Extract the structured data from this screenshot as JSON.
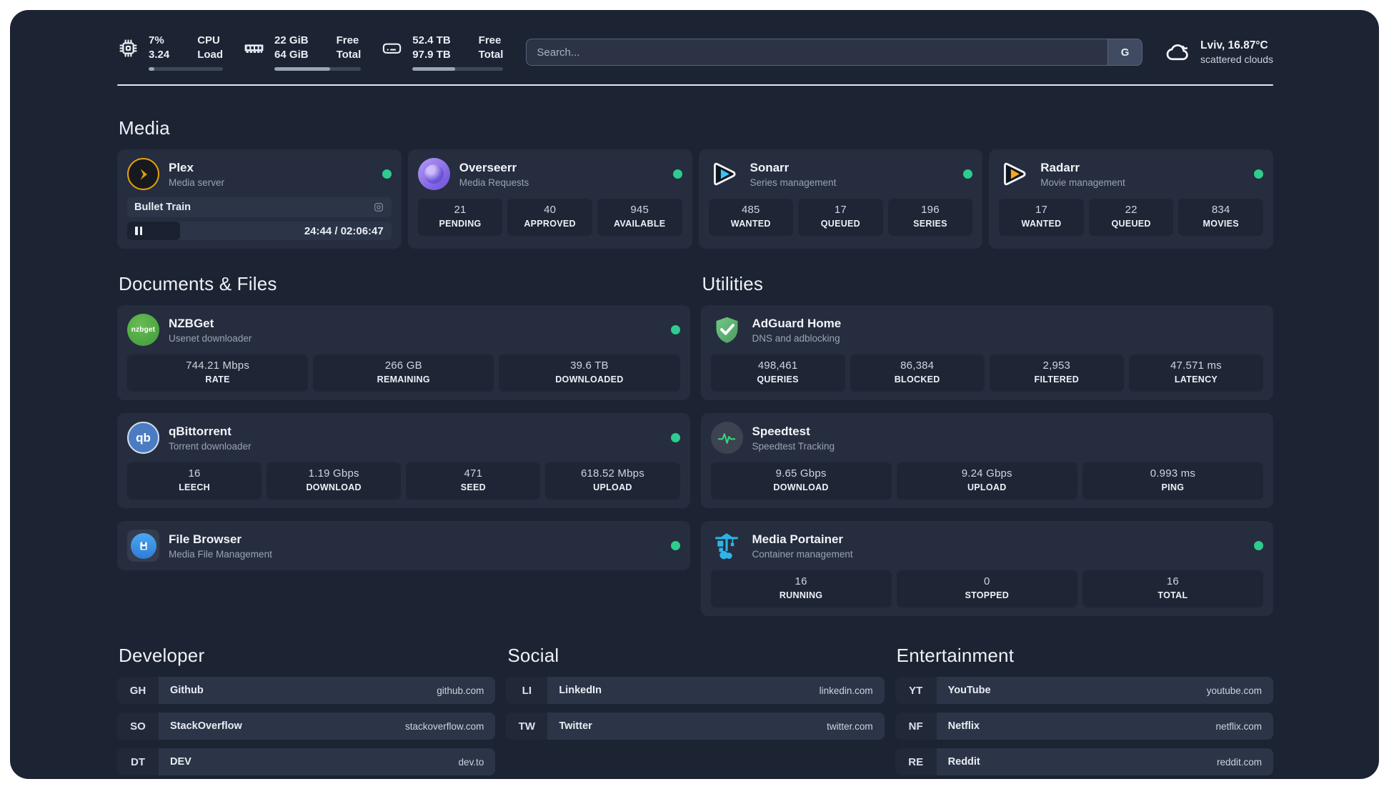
{
  "colors": {
    "dashboard_background": "#1c2332",
    "card_background": "#252d3e",
    "stat_box_background": "#1e2636",
    "status_online_green": "#2ecc8f",
    "divider": "#e4e9f2",
    "plex_accent": "#e5a00d",
    "sonarr_accent": "#35c5f4",
    "radarr_accent": "#f5a623",
    "portainer_accent": "#2fb3e8"
  },
  "topbar": {
    "cpu": {
      "values": [
        "7%",
        "3.24"
      ],
      "labels": [
        "CPU",
        "Load"
      ],
      "progress_pct": 8
    },
    "memory": {
      "values": [
        "22 GiB",
        "64 GiB"
      ],
      "labels": [
        "Free",
        "Total"
      ],
      "progress_pct": 64
    },
    "disk": {
      "values": [
        "52.4 TB",
        "97.9 TB"
      ],
      "labels": [
        "Free",
        "Total"
      ],
      "progress_pct": 47
    },
    "search": {
      "placeholder": "Search...",
      "button_label": "G"
    },
    "weather": {
      "location": "Lviv, 16.87°C",
      "condition": "scattered clouds"
    }
  },
  "media": {
    "title": "Media",
    "plex": {
      "name": "Plex",
      "subtitle": "Media server",
      "now_playing": "Bullet Train",
      "time_display": "24:44 / 02:06:47",
      "progress_pct": 20
    },
    "overseerr": {
      "name": "Overseerr",
      "subtitle": "Media Requests",
      "stats": [
        {
          "value": "21",
          "label": "PENDING"
        },
        {
          "value": "40",
          "label": "APPROVED"
        },
        {
          "value": "945",
          "label": "AVAILABLE"
        }
      ]
    },
    "sonarr": {
      "name": "Sonarr",
      "subtitle": "Series management",
      "stats": [
        {
          "value": "485",
          "label": "WANTED"
        },
        {
          "value": "17",
          "label": "QUEUED"
        },
        {
          "value": "196",
          "label": "SERIES"
        }
      ]
    },
    "radarr": {
      "name": "Radarr",
      "subtitle": "Movie management",
      "stats": [
        {
          "value": "17",
          "label": "WANTED"
        },
        {
          "value": "22",
          "label": "QUEUED"
        },
        {
          "value": "834",
          "label": "MOVIES"
        }
      ]
    }
  },
  "documents": {
    "title": "Documents & Files",
    "nzbget": {
      "name": "NZBGet",
      "subtitle": "Usenet downloader",
      "stats": [
        {
          "value": "744.21 Mbps",
          "label": "RATE"
        },
        {
          "value": "266 GB",
          "label": "REMAINING"
        },
        {
          "value": "39.6 TB",
          "label": "DOWNLOADED"
        }
      ]
    },
    "qbittorrent": {
      "name": "qBittorrent",
      "subtitle": "Torrent downloader",
      "stats": [
        {
          "value": "16",
          "label": "LEECH"
        },
        {
          "value": "1.19 Gbps",
          "label": "DOWNLOAD"
        },
        {
          "value": "471",
          "label": "SEED"
        },
        {
          "value": "618.52 Mbps",
          "label": "UPLOAD"
        }
      ]
    },
    "filebrowser": {
      "name": "File Browser",
      "subtitle": "Media File Management"
    }
  },
  "utilities": {
    "title": "Utilities",
    "adguard": {
      "name": "AdGuard Home",
      "subtitle": "DNS and adblocking",
      "stats": [
        {
          "value": "498,461",
          "label": "QUERIES"
        },
        {
          "value": "86,384",
          "label": "BLOCKED"
        },
        {
          "value": "2,953",
          "label": "FILTERED"
        },
        {
          "value": "47.571 ms",
          "label": "LATENCY"
        }
      ]
    },
    "speedtest": {
      "name": "Speedtest",
      "subtitle": "Speedtest Tracking",
      "stats": [
        {
          "value": "9.65 Gbps",
          "label": "DOWNLOAD"
        },
        {
          "value": "9.24 Gbps",
          "label": "UPLOAD"
        },
        {
          "value": "0.993 ms",
          "label": "PING"
        }
      ]
    },
    "portainer": {
      "name": "Media Portainer",
      "subtitle": "Container management",
      "stats": [
        {
          "value": "16",
          "label": "RUNNING"
        },
        {
          "value": "0",
          "label": "STOPPED"
        },
        {
          "value": "16",
          "label": "TOTAL"
        }
      ]
    }
  },
  "bookmarks": {
    "developer": {
      "title": "Developer",
      "items": [
        {
          "abbr": "GH",
          "name": "Github",
          "url": "github.com"
        },
        {
          "abbr": "SO",
          "name": "StackOverflow",
          "url": "stackoverflow.com"
        },
        {
          "abbr": "DT",
          "name": "DEV",
          "url": "dev.to"
        }
      ]
    },
    "social": {
      "title": "Social",
      "items": [
        {
          "abbr": "LI",
          "name": "LinkedIn",
          "url": "linkedin.com"
        },
        {
          "abbr": "TW",
          "name": "Twitter",
          "url": "twitter.com"
        }
      ]
    },
    "entertainment": {
      "title": "Entertainment",
      "items": [
        {
          "abbr": "YT",
          "name": "YouTube",
          "url": "youtube.com"
        },
        {
          "abbr": "NF",
          "name": "Netflix",
          "url": "netflix.com"
        },
        {
          "abbr": "RE",
          "name": "Reddit",
          "url": "reddit.com"
        }
      ]
    }
  }
}
